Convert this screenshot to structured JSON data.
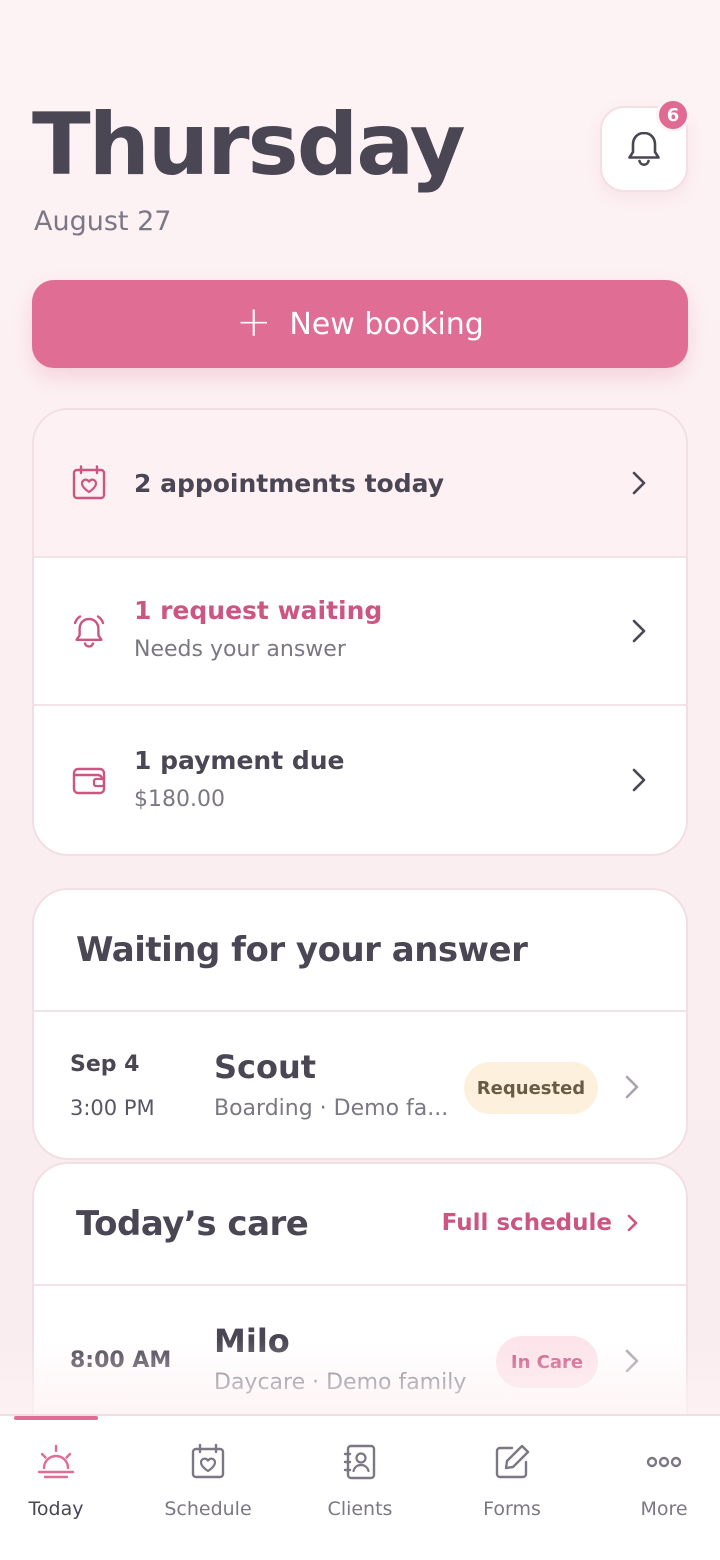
{
  "header": {
    "day": "Thursday",
    "date": "August 27",
    "notifications_count": "6"
  },
  "new_booking": {
    "label": "New booking"
  },
  "summary": {
    "appointments": {
      "title": "2 appointments today"
    },
    "requests": {
      "title": "1 request waiting",
      "subtitle": "Needs your answer"
    },
    "payments": {
      "title": "1 payment due",
      "subtitle": "$180.00"
    }
  },
  "waiting": {
    "title": "Waiting for your answer",
    "items": [
      {
        "date": "Sep 4",
        "time": "3:00 PM",
        "name": "Scout",
        "detail": "Boarding · Demo fa...",
        "status": "Requested"
      }
    ]
  },
  "care": {
    "title": "Today’s care",
    "link_label": "Full schedule",
    "items": [
      {
        "time": "8:00 AM",
        "name": "Milo",
        "detail": "Daycare · Demo family",
        "status": "In Care"
      }
    ]
  },
  "tabs": [
    {
      "label": "Today",
      "icon": "sunrise-icon",
      "active": true
    },
    {
      "label": "Schedule",
      "icon": "calendar-heart-icon"
    },
    {
      "label": "Clients",
      "icon": "contacts-book-icon"
    },
    {
      "label": "Forms",
      "icon": "edit-form-icon"
    },
    {
      "label": "More",
      "icon": "more-dots-icon"
    }
  ],
  "colors": {
    "accent": "#df6d94",
    "accent_text": "#cc5582",
    "text": "#4a4654",
    "muted": "#7c7784",
    "requested_bg": "#fdf0dc",
    "incare_bg": "#fce4ea"
  }
}
